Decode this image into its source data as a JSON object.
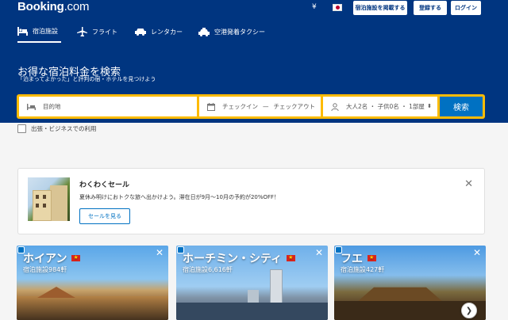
{
  "brand": {
    "name": "Booking",
    "suffix": ".com"
  },
  "header": {
    "currency": "¥",
    "list_property": "宿泊施設を掲載する",
    "register": "登録する",
    "login": "ログイン"
  },
  "nav": {
    "items": [
      {
        "label": "宿泊施設",
        "icon": "bed-icon",
        "active": true
      },
      {
        "label": "フライト",
        "icon": "plane-icon",
        "active": false
      },
      {
        "label": "レンタカー",
        "icon": "car-icon",
        "active": false
      },
      {
        "label": "空港発着タクシー",
        "icon": "taxi-icon",
        "active": false
      }
    ]
  },
  "hero": {
    "title": "お得な宿泊料金を検索",
    "subtitle": "「泊まってよかった」と評判の宿・ホテルを見つけよう"
  },
  "search": {
    "destination_placeholder": "目的地",
    "checkin": "チェックイン",
    "dash": "—",
    "checkout": "チェックアウト",
    "guests": "大人2名 ・ 子供0名 ・ 1部屋",
    "button": "検索",
    "business_trip": "出張・ビジネスでの利用"
  },
  "promo": {
    "title": "わくわくセール",
    "text": "夏休み明けにおトクな旅へ出かけよう。滞在日が9月〜10月の予約が20%OFF！",
    "button": "セールを見る"
  },
  "destinations": [
    {
      "name": "ホイアン",
      "count": "宿泊施設984軒"
    },
    {
      "name": "ホーチミン・シティ",
      "count": "宿泊施設6,616軒"
    },
    {
      "name": "フエ",
      "count": "宿泊施設427軒"
    }
  ],
  "colors": {
    "brand": "#003580",
    "accent": "#febb02",
    "primary": "#0071c2"
  }
}
